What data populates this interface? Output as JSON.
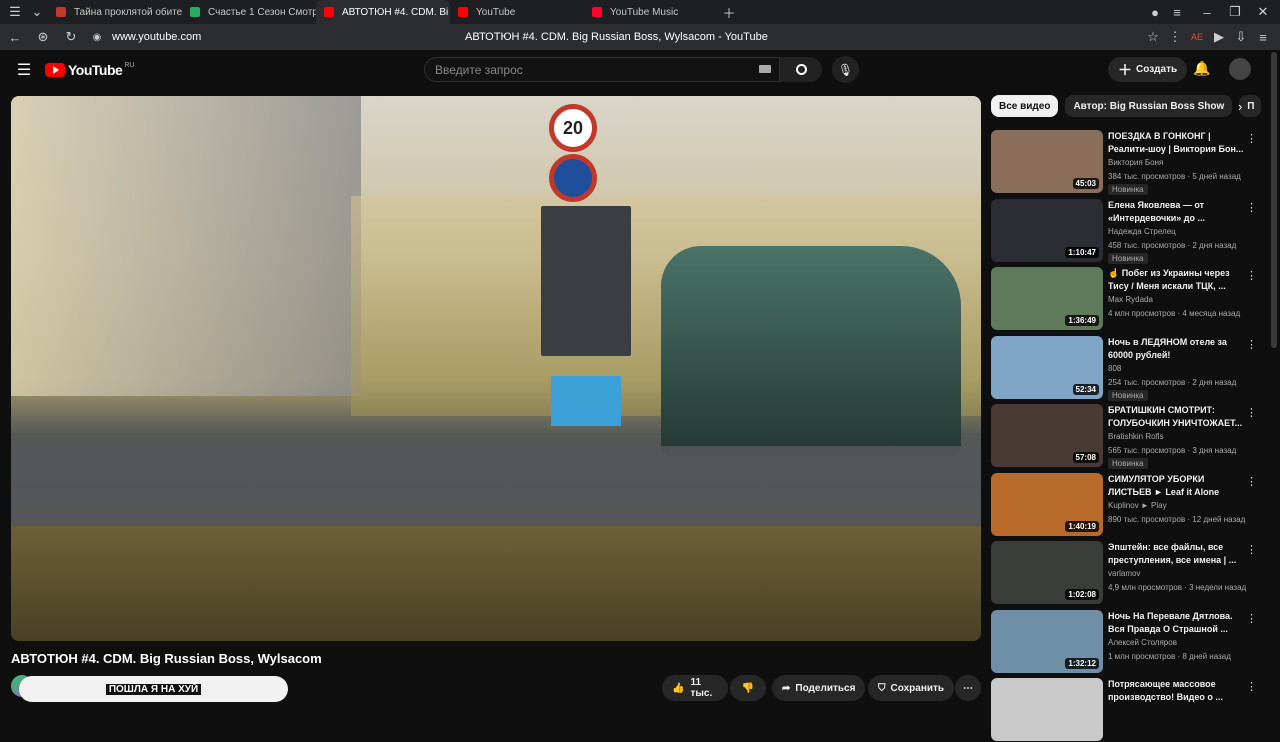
{
  "browser": {
    "tabs": [
      {
        "label": "Тайна проклятой обител",
        "color": "#c0392b"
      },
      {
        "label": "Счастье 1 Сезон Смотре",
        "color": "#27ae60"
      },
      {
        "label": "АВТОТЮН #4. CDM. Bi",
        "color": "#ff0000",
        "active": true
      },
      {
        "label": "YouTube",
        "color": "#ff0000"
      },
      {
        "label": "YouTube Music",
        "color": "#ff0033"
      }
    ],
    "url": "www.youtube.com",
    "page_title": "АВТОТЮН #4. CDM. Big Russian Boss, Wylsacom - YouTube"
  },
  "header": {
    "logo_text": "YouTube",
    "region": "RU",
    "search_placeholder": "Введите запрос",
    "create_label": "Создать"
  },
  "video": {
    "title": "АВТОТЮН #4. CDM. Big Russian Boss, Wylsacom",
    "overlay_text": "ПОШЛА Я НА ХУЙ",
    "likes": "11 тыс.",
    "share_label": "Поделиться",
    "save_label": "Сохранить"
  },
  "chips": [
    "Все видео",
    "Автор: Big Russian Boss Show",
    "П"
  ],
  "recommendations": [
    {
      "title": "ПОЕЗДКА В ГОНКОНГ | Реалити-шоу | Виктория Бон...",
      "channel": "Виктория Боня",
      "meta": "384 тыс. просмотров · 5 дней назад",
      "badge": "Новинка",
      "duration": "45:03",
      "thumb_color": "#8a6e5a"
    },
    {
      "title": "Елена Яковлева — от «Интердевочки» до ...",
      "channel": "Надежда Стрелец",
      "meta": "458 тыс. просмотров · 2 дня назад",
      "badge": "Новинка",
      "duration": "1:10:47",
      "thumb_color": "#2c2c34"
    },
    {
      "title": "☝ Побег из Украины через Тису / Меня искали ТЦК, ...",
      "channel": "Max Rydada",
      "meta": "4 млн просмотров · 4 месяца назад",
      "badge": "",
      "duration": "1:36:49",
      "thumb_color": "#5f7a5a"
    },
    {
      "title": "Ночь в ЛЕДЯНОМ отеле за 60000 рублей!",
      "channel": "808",
      "meta": "254 тыс. просмотров · 2 дня назад",
      "badge": "Новинка",
      "duration": "52:34",
      "thumb_color": "#7fa6c6"
    },
    {
      "title": "БРАТИШКИН СМОТРИТ: ГОЛУБОЧКИН УНИЧТОЖАЕТ...",
      "channel": "Bratishkin Rofls",
      "meta": "565 тыс. просмотров · 3 дня назад",
      "badge": "Новинка",
      "duration": "57:08",
      "thumb_color": "#4a3a36"
    },
    {
      "title": "СИМУЛЯТОР УБОРКИ ЛИСТЬЕВ ► Leaf it Alone",
      "channel": "Kuplinov ► Play",
      "meta": "890 тыс. просмотров · 12 дней назад",
      "badge": "",
      "duration": "1:40:19",
      "thumb_color": "#b76a2a"
    },
    {
      "title": "Эпштейн: все файлы, все преступления, все имена | ...",
      "channel": "varlamov",
      "meta": "4,9 млн просмотров · 3 недели назад",
      "badge": "",
      "duration": "1:02:08",
      "thumb_color": "#3a3d3a"
    },
    {
      "title": "Ночь На Перевале Дятлова. Вся Правда О Страшной ...",
      "channel": "Алексей Столяров",
      "meta": "1 млн просмотров · 8 дней назад",
      "badge": "",
      "duration": "1:32:12",
      "thumb_color": "#6f8fa6"
    },
    {
      "title": "Потрясающее массовое производство! Видео о ...",
      "channel": "",
      "meta": "",
      "badge": "",
      "duration": "",
      "thumb_color": "#c9c9c9"
    }
  ]
}
